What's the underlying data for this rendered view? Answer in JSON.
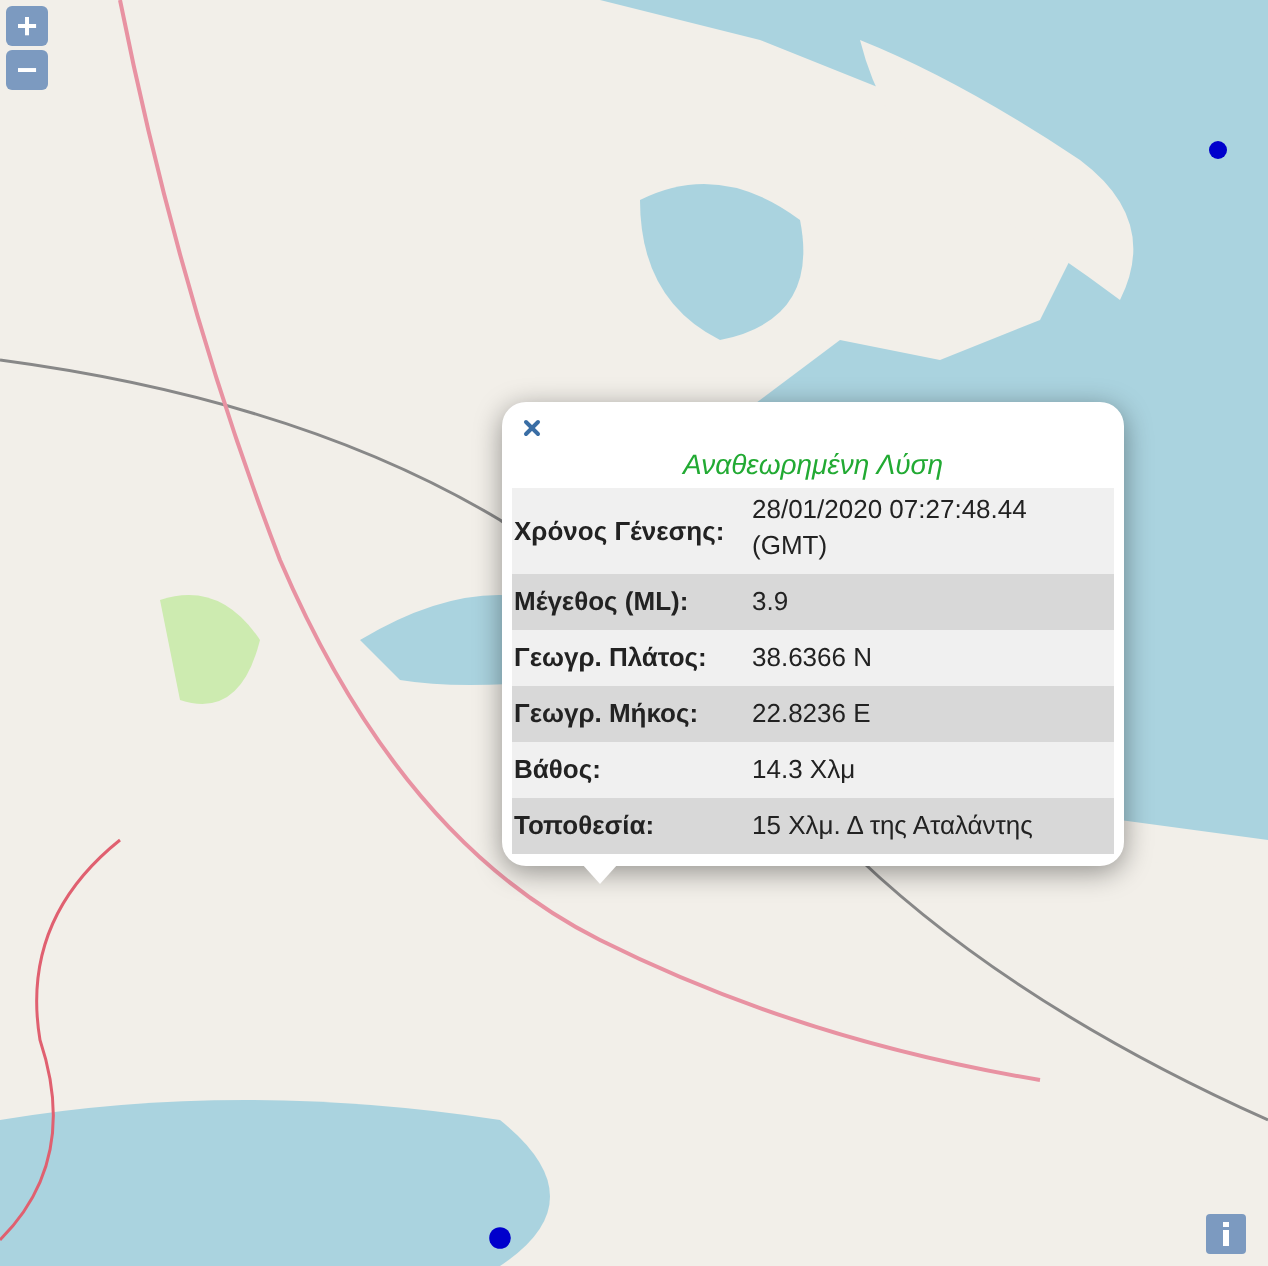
{
  "zoom_controls": [
    {
      "label": "+"
    },
    {
      "label": "−"
    }
  ],
  "popup": {
    "title": "Αναθεωρημένη Λύση",
    "rows": [
      {
        "label": "Χρόνος Γένεσης:",
        "value": "28/01/2020 07:27:48.44 (GMT)"
      },
      {
        "label": "Μέγεθος (ML):",
        "value": "3.9"
      },
      {
        "label": "Γεωγρ. Πλάτος:",
        "value": "38.6366 N"
      },
      {
        "label": "Γεωγρ. Μήκος:",
        "value": "22.8236 E"
      },
      {
        "label": "Βάθος:",
        "value": "14.3 Χλμ"
      },
      {
        "label": "Τοποθεσία:",
        "value": "15 Χλμ. Δ της Αταλάντης"
      }
    ]
  }
}
